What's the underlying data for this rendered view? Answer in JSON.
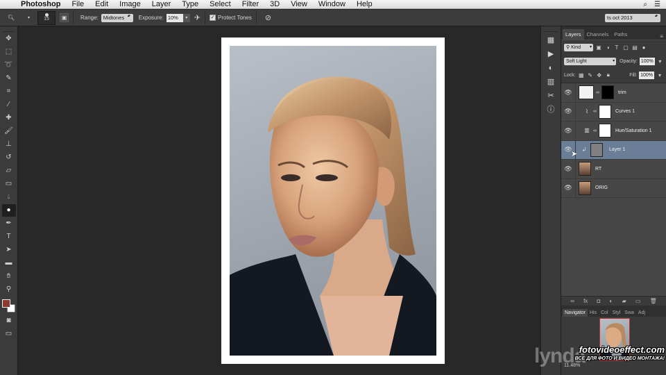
{
  "menubar": {
    "app_name": "Photoshop",
    "items": [
      "File",
      "Edit",
      "Image",
      "Layer",
      "Type",
      "Select",
      "Filter",
      "3D",
      "View",
      "Window",
      "Help"
    ]
  },
  "options": {
    "brush_size": "15",
    "range_label": "Range:",
    "range_value": "Midtones",
    "exposure_label": "Exposure:",
    "exposure_value": "10%",
    "protect_tones_label": "Protect Tones",
    "protect_tones_checked": true,
    "workspace": "ts oct 2013"
  },
  "toolbar": {
    "tools": [
      "move-icon",
      "marquee-icon",
      "lasso-icon",
      "quick-select-icon",
      "crop-icon",
      "eyedropper-icon",
      "healing-icon",
      "brush-icon",
      "stamp-icon",
      "history-brush-icon",
      "eraser-icon",
      "gradient-icon",
      "blur-icon",
      "dodge-icon",
      "pen-icon",
      "type-icon",
      "path-select-icon",
      "rectangle-icon",
      "hand-icon",
      "zoom-icon"
    ],
    "active_tool": "dodge-icon",
    "fg_color": "#8b3a33",
    "bg_color": "#ffffff"
  },
  "layers_panel": {
    "tabs": [
      "Layers",
      "Channels",
      "Paths"
    ],
    "active_tab": "Layers",
    "filter_kind": "Kind",
    "blend_mode": "Soft Light",
    "opacity_label": "Opacity:",
    "opacity_value": "100%",
    "lock_label": "Lock:",
    "fill_label": "Fill:",
    "fill_value": "100%",
    "layers": [
      {
        "name": "trim",
        "type": "mask",
        "selected": false
      },
      {
        "name": "Curves 1",
        "type": "curves",
        "selected": false
      },
      {
        "name": "Hue/Saturation 1",
        "type": "huesat",
        "selected": false
      },
      {
        "name": "Layer 1",
        "type": "clipped",
        "selected": true
      },
      {
        "name": "RT",
        "type": "photo",
        "selected": false
      },
      {
        "name": "ORIG",
        "type": "photo",
        "selected": false
      }
    ]
  },
  "navigator": {
    "tabs": [
      "Navigator",
      "His",
      "Col",
      "Styl",
      "Swa",
      "Adj"
    ],
    "active_tab": "Navigator",
    "zoom": "11.48%"
  },
  "watermark": {
    "line1": "fotovideoeffect.com",
    "line2": "ВСЕ ДЛЯ ФОТО И ВИДЕО МОНТАЖА!",
    "brand": "lynda"
  }
}
